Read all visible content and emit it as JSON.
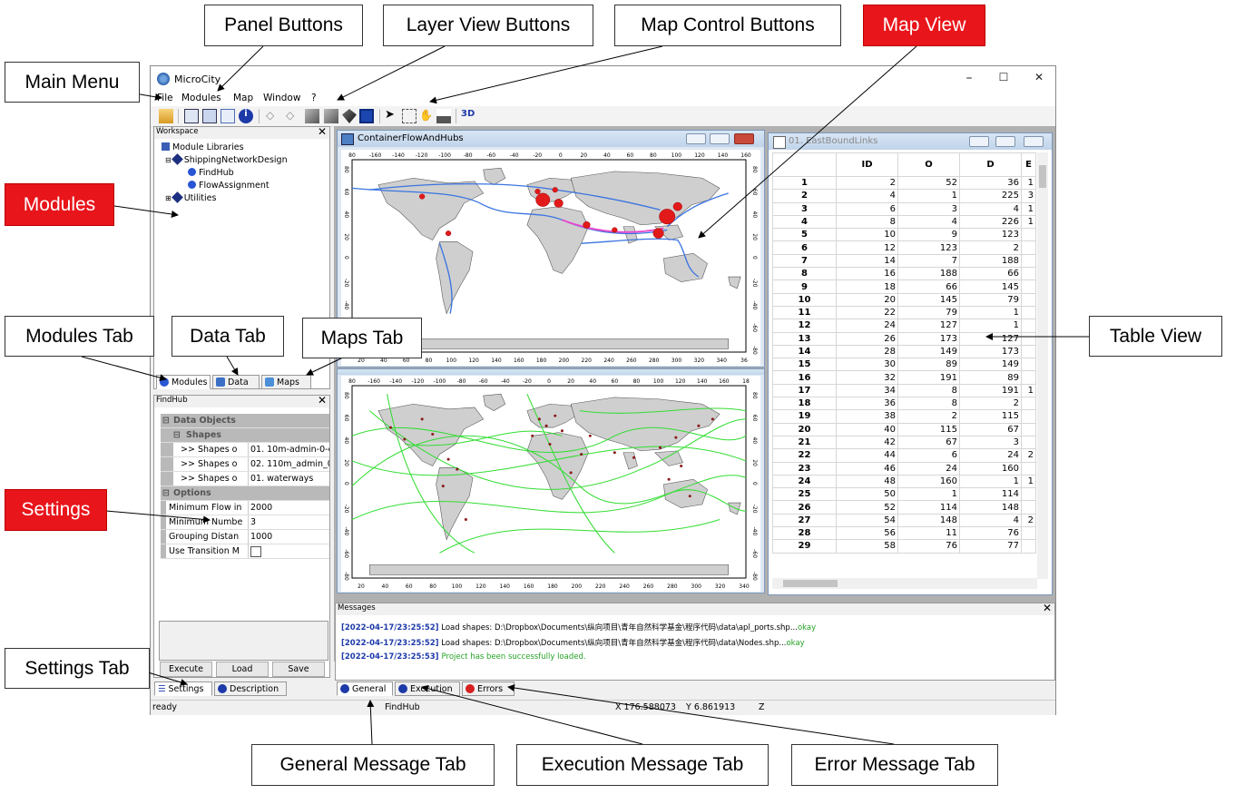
{
  "callouts": {
    "panel_buttons": "Panel Buttons",
    "layer_view_buttons": "Layer View Buttons",
    "map_control_buttons": "Map Control Buttons",
    "map_view": "Map View",
    "main_menu": "Main Menu",
    "modules": "Modules",
    "modules_tab": "Modules Tab",
    "data_tab": "Data Tab",
    "maps_tab": "Maps Tab",
    "table_view": "Table View",
    "settings": "Settings",
    "settings_tab": "Settings Tab",
    "general_message_tab": "General Message Tab",
    "execution_message_tab": "Execution Message Tab",
    "error_message_tab": "Error Message Tab"
  },
  "colors": {
    "accent_red": "#e8151b",
    "map_land": "#cfcfcf",
    "route_blue": "#3a74e0",
    "route_green": "#33dd33",
    "hub_red": "#e31a1a"
  },
  "window": {
    "title": "MicroCity",
    "minimize": "–",
    "maximize": "☐",
    "close": "✕"
  },
  "menu": [
    "File",
    "Modules",
    "Map",
    "Window",
    "?"
  ],
  "workspace": {
    "title": "Workspace",
    "close": "✕",
    "tree": [
      {
        "label": "Module Libraries",
        "icon": "library-icon"
      },
      {
        "label": "ShippingNetworkDesign",
        "icon": "module-group-icon"
      },
      {
        "label": "FindHub",
        "icon": "module-icon"
      },
      {
        "label": "FlowAssignment",
        "icon": "module-icon"
      },
      {
        "label": "Utilities",
        "icon": "module-group-icon"
      }
    ],
    "tabs": [
      "Modules",
      "Data",
      "Maps"
    ]
  },
  "settings_panel": {
    "title": "FindHub",
    "close": "✕",
    "groups": {
      "data_objects": "Data Objects",
      "shapes": "Shapes",
      "options": "Options"
    },
    "shapes": [
      {
        "key": ">> Shapes o",
        "value": "01. 10m-admin-0-c"
      },
      {
        "key": ">> Shapes o",
        "value": "02. 110m_admin_0"
      },
      {
        "key": ">> Shapes o",
        "value": "01. waterways"
      }
    ],
    "options": [
      {
        "key": "Minimum Flow in",
        "value": "2000"
      },
      {
        "key": "Minimum Numbe",
        "value": "3"
      },
      {
        "key": "Grouping Distan",
        "value": "1000"
      },
      {
        "key": "Use Transition M",
        "value": ""
      }
    ],
    "buttons": {
      "execute": "Execute",
      "load": "Load",
      "save": "Save"
    },
    "tabs": [
      "Settings",
      "Description"
    ]
  },
  "map_window_1": {
    "title": "ContainerFlowAndHubs",
    "ticks_top": [
      "80",
      "-160",
      "-140",
      "-120",
      "-100",
      "-80",
      "-60",
      "-40",
      "-20",
      "0",
      "20",
      "40",
      "60",
      "80",
      "100",
      "120",
      "140",
      "160"
    ],
    "ticks_bottom": [
      "20",
      "40",
      "60",
      "80",
      "100",
      "120",
      "140",
      "160",
      "180",
      "200",
      "220",
      "240",
      "260",
      "280",
      "300",
      "320",
      "340",
      "36"
    ],
    "ticks_left": [
      "80",
      "60",
      "40",
      "20",
      "0",
      "-20",
      "-40",
      "-60",
      "-80"
    ]
  },
  "map_window_2": {
    "ticks_top": [
      "80",
      "-160",
      "-140",
      "-120",
      "-100",
      "-80",
      "-60",
      "-40",
      "-20",
      "0",
      "20",
      "40",
      "60",
      "80",
      "100",
      "120",
      "140",
      "160",
      "18"
    ],
    "ticks_bottom": [
      "20",
      "40",
      "60",
      "80",
      "100",
      "120",
      "140",
      "160",
      "180",
      "200",
      "220",
      "240",
      "260",
      "280",
      "300",
      "320",
      "340"
    ],
    "ticks_left": [
      "80",
      "60",
      "40",
      "20",
      "0",
      "-20",
      "-40",
      "-60",
      "-80"
    ]
  },
  "table_window": {
    "title": "01. EastBoundLinks",
    "columns": [
      "ID",
      "O",
      "D",
      "E"
    ],
    "rows": [
      [
        "1",
        "2",
        "52",
        "36",
        "1"
      ],
      [
        "2",
        "4",
        "1",
        "225",
        "3"
      ],
      [
        "3",
        "6",
        "3",
        "4",
        "1"
      ],
      [
        "4",
        "8",
        "4",
        "226",
        "1"
      ],
      [
        "5",
        "10",
        "9",
        "123",
        ""
      ],
      [
        "6",
        "12",
        "123",
        "2",
        ""
      ],
      [
        "7",
        "14",
        "7",
        "188",
        ""
      ],
      [
        "8",
        "16",
        "188",
        "66",
        ""
      ],
      [
        "9",
        "18",
        "66",
        "145",
        ""
      ],
      [
        "10",
        "20",
        "145",
        "79",
        ""
      ],
      [
        "11",
        "22",
        "79",
        "1",
        ""
      ],
      [
        "12",
        "24",
        "127",
        "1",
        ""
      ],
      [
        "13",
        "26",
        "173",
        "127",
        ""
      ],
      [
        "14",
        "28",
        "149",
        "173",
        ""
      ],
      [
        "15",
        "30",
        "89",
        "149",
        ""
      ],
      [
        "16",
        "32",
        "191",
        "89",
        ""
      ],
      [
        "17",
        "34",
        "8",
        "191",
        "1"
      ],
      [
        "18",
        "36",
        "8",
        "2",
        ""
      ],
      [
        "19",
        "38",
        "2",
        "115",
        ""
      ],
      [
        "20",
        "40",
        "115",
        "67",
        ""
      ],
      [
        "21",
        "42",
        "67",
        "3",
        ""
      ],
      [
        "22",
        "44",
        "6",
        "24",
        "2"
      ],
      [
        "23",
        "46",
        "24",
        "160",
        ""
      ],
      [
        "24",
        "48",
        "160",
        "1",
        "1"
      ],
      [
        "25",
        "50",
        "1",
        "114",
        ""
      ],
      [
        "26",
        "52",
        "114",
        "148",
        ""
      ],
      [
        "27",
        "54",
        "148",
        "4",
        "2"
      ],
      [
        "28",
        "56",
        "11",
        "76",
        ""
      ],
      [
        "29",
        "58",
        "76",
        "77",
        ""
      ]
    ]
  },
  "messages": {
    "title": "Messages",
    "close": "✕",
    "lines": [
      {
        "ts": "[2022-04-17/23:25:52]",
        "text": " Load shapes: D:\\Dropbox\\Documents\\纵向项目\\青年自然科学基金\\程序代码\\data\\apl_ports.shp...",
        "ok": "okay"
      },
      {
        "ts": "[2022-04-17/23:25:52]",
        "text": " Load shapes: D:\\Dropbox\\Documents\\纵向项目\\青年自然科学基金\\程序代码\\data\\Nodes.shp...",
        "ok": "okay"
      },
      {
        "ts": "[2022-04-17/23:25:53]",
        "text": "",
        "ok": "Project has been successfully loaded."
      }
    ],
    "tabs": [
      "General",
      "Execution",
      "Errors"
    ]
  },
  "status": {
    "state": "ready",
    "module": "FindHub",
    "x": "X 176.588073",
    "y": "Y 6.861913",
    "z": "Z"
  }
}
